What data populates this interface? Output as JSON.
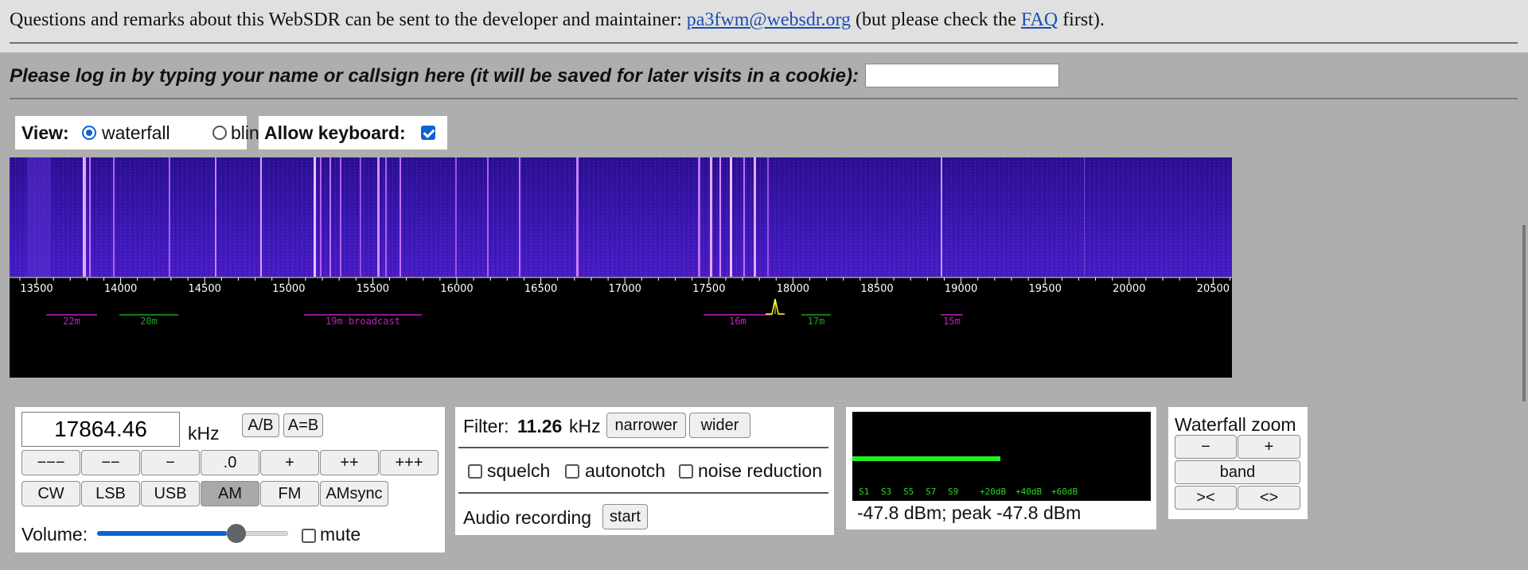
{
  "header": {
    "notice_text": "Questions and remarks about this WebSDR can be sent to the developer and maintainer: ",
    "email": "pa3fwm@websdr.org",
    "middle_text": " (but please check the ",
    "faq": "FAQ",
    "end_text": " first)."
  },
  "login": {
    "prompt": "Please log in by typing your name or callsign here (it will be saved for later visits in a cookie):",
    "value": ""
  },
  "view": {
    "label": "View:",
    "options": [
      "waterfall",
      "blind"
    ],
    "selected": "waterfall"
  },
  "keyboard": {
    "label": "Allow keyboard:",
    "checked": true
  },
  "waterfall": {
    "ticks": [
      "13500",
      "14000",
      "14500",
      "15000",
      "15500",
      "16000",
      "16500",
      "17000",
      "17500",
      "18000",
      "18500",
      "19000",
      "19500",
      "20000",
      "20500"
    ],
    "bands": [
      {
        "label": "22m",
        "color": "#c020c0"
      },
      {
        "label": "20m",
        "color": "#20a020"
      },
      {
        "label": "19m broadcast",
        "color": "#c020c0"
      },
      {
        "label": "16m",
        "color": "#c020c0"
      },
      {
        "label": "17m",
        "color": "#20a020"
      },
      {
        "label": "15m",
        "color": "#c020c0"
      }
    ]
  },
  "tuning": {
    "frequency": "17864.46",
    "unit": "kHz",
    "ab_label": "A/B",
    "aeqb_label": "A=B",
    "step_buttons": [
      "−−−",
      "−−",
      "−",
      ".0",
      "+",
      "++",
      "+++"
    ],
    "modes": [
      "CW",
      "LSB",
      "USB",
      "AM",
      "FM",
      "AMsync"
    ],
    "active_mode": "AM",
    "volume_label": "Volume:",
    "volume_level_fraction": 0.73,
    "mute_label": "mute"
  },
  "filter": {
    "label": "Filter:",
    "width": "11.26",
    "unit": "kHz",
    "narrower": "narrower",
    "wider": "wider",
    "squelch": "squelch",
    "autonotch": "autonotch",
    "noise_reduction": "noise reduction",
    "recording_label": "Audio recording",
    "start": "start"
  },
  "smeter": {
    "scale": [
      "S1",
      "S3",
      "S5",
      "S7",
      "S9",
      "+20dB",
      "+40dB",
      "+60dB"
    ],
    "level_fraction": 0.61,
    "reading": "-47.8 dBm; peak  -47.8 dBm"
  },
  "zoom": {
    "title": "Waterfall zoom",
    "minus": "−",
    "plus": "+",
    "band": "band",
    "narrow": "><",
    "wide": "<>"
  },
  "colors": {
    "waterfall_bg": "#3a17b0",
    "signal": "#f0b0ff",
    "meter_bar": "#22ee22",
    "meter_text": "#22dd22",
    "accent": "#0b63d6"
  }
}
